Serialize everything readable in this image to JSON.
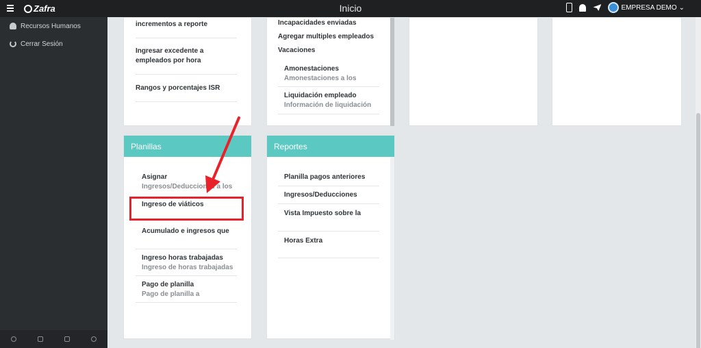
{
  "topbar": {
    "brand": "Zafra",
    "title": "Inicio",
    "company": "EMPRESA DEMO",
    "company_caret": "⌄"
  },
  "sidebar": {
    "items": [
      {
        "label": "Recursos Humanos",
        "icon": "user-icon"
      },
      {
        "label": "Cerrar Sesión",
        "icon": "power-icon"
      }
    ],
    "footer_icons": [
      "gear-icon",
      "monitor-icon",
      "lock-icon",
      "power-icon"
    ]
  },
  "cards": {
    "col1_top": {
      "items": [
        {
          "label": "incrementos a reporte"
        },
        {
          "label": "Ingresar excedente a empleados por hora"
        },
        {
          "label": "Rangos y porcentajes ISR"
        }
      ]
    },
    "col2_top": {
      "items": [
        {
          "label": "Incapacidades enviadas"
        },
        {
          "label": "Agregar multiples empleados"
        },
        {
          "label": "Vacaciones"
        },
        {
          "label": "Amonestaciones",
          "sub": "Amonestaciones a los"
        },
        {
          "label": "Liquidación empleado",
          "sub": "Información de liquidación"
        }
      ]
    },
    "planillas": {
      "title": "Planillas",
      "items": [
        {
          "label": "Asignar",
          "sub": "Ingresos/Deducciones a los"
        },
        {
          "label": "Ingreso de viáticos"
        },
        {
          "label": "Acumulado e ingresos que"
        },
        {
          "label": "Ingreso horas trabajadas",
          "sub": "Ingreso de horas trabajadas"
        },
        {
          "label": "Pago de planilla",
          "sub": "Pago de planilla a"
        }
      ]
    },
    "reportes": {
      "title": "Reportes",
      "items": [
        {
          "label": "Planilla pagos anteriores"
        },
        {
          "label": "Ingresos/Deducciones"
        },
        {
          "label": "Vista Impuesto sobre la"
        },
        {
          "label": "Horas Extra"
        }
      ]
    }
  },
  "colors": {
    "header_teal": "#5bc9c2",
    "annotation_red": "#e8212a"
  }
}
